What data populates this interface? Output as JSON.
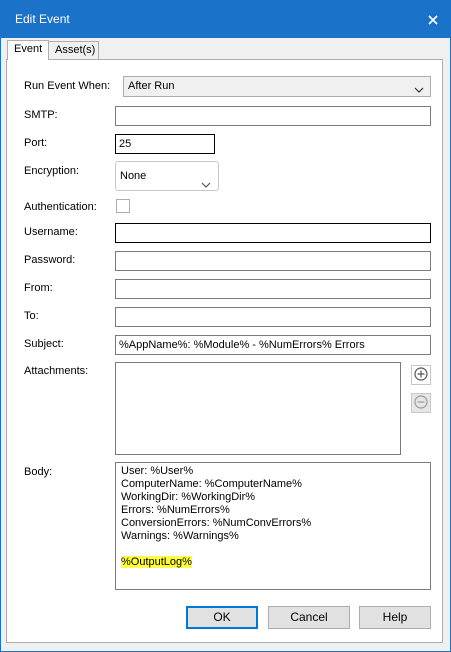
{
  "window": {
    "title": "Edit Event"
  },
  "tabs": [
    {
      "label": "Event"
    },
    {
      "label": "Asset(s)"
    }
  ],
  "form": {
    "run_event_when": {
      "label": "Run Event When:",
      "value": "After Run"
    },
    "smtp": {
      "label": "SMTP:",
      "value": ""
    },
    "port": {
      "label": "Port:",
      "value": "25"
    },
    "encryption": {
      "label": "Encryption:",
      "value": "None"
    },
    "authentication": {
      "label": "Authentication:",
      "checked": false
    },
    "username": {
      "label": "Username:",
      "value": ""
    },
    "password": {
      "label": "Password:",
      "value": ""
    },
    "from": {
      "label": "From:",
      "value": ""
    },
    "to": {
      "label": "To:",
      "value": ""
    },
    "subject": {
      "label": "Subject:",
      "value": "%AppName%: %Module% - %NumErrors% Errors"
    },
    "attachments": {
      "label": "Attachments:"
    },
    "body": {
      "label": "Body:",
      "lines": [
        "User: %User%",
        "ComputerName: %ComputerName%",
        "WorkingDir: %WorkingDir%",
        "Errors: %NumErrors%",
        "ConversionErrors: %NumConvErrors%",
        "Warnings: %Warnings%",
        "",
        "%OutputLog%"
      ],
      "highlight_color": "#ffff3d"
    }
  },
  "buttons": {
    "ok": "OK",
    "cancel": "Cancel",
    "help": "Help"
  },
  "colors": {
    "titlebar": "#1a73c9",
    "accent": "#0078d7"
  },
  "icons": {
    "close": "close-icon",
    "add": "plus-circle-icon",
    "remove": "minus-circle-icon",
    "dropdown": "chevron-down-icon"
  }
}
